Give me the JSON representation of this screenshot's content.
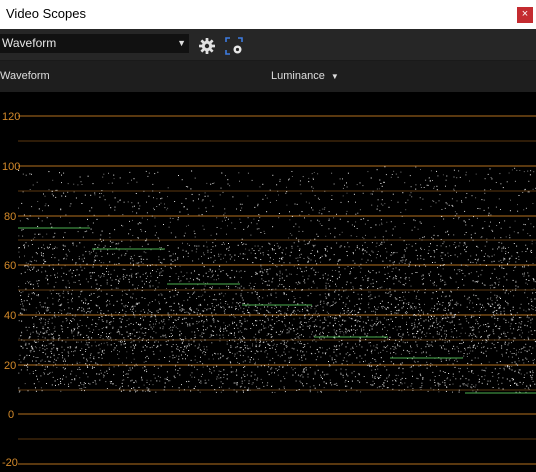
{
  "window": {
    "title": "Video Scopes",
    "close_label": "×"
  },
  "toolbar": {
    "scope_type": "Waveform",
    "settings_icon": "gear-icon",
    "capture_icon": "capture-icon"
  },
  "subbar": {
    "mode_label": "Waveform",
    "channel_label": "Luminance"
  },
  "scope": {
    "ticks": [
      "120",
      "100",
      "80",
      "60",
      "40",
      "20",
      "0",
      "-20"
    ],
    "grid_color": "#b5701e",
    "tick_color": "#d48a2a",
    "trace_color": "#ffffff",
    "marker_color": "#4caf50"
  }
}
